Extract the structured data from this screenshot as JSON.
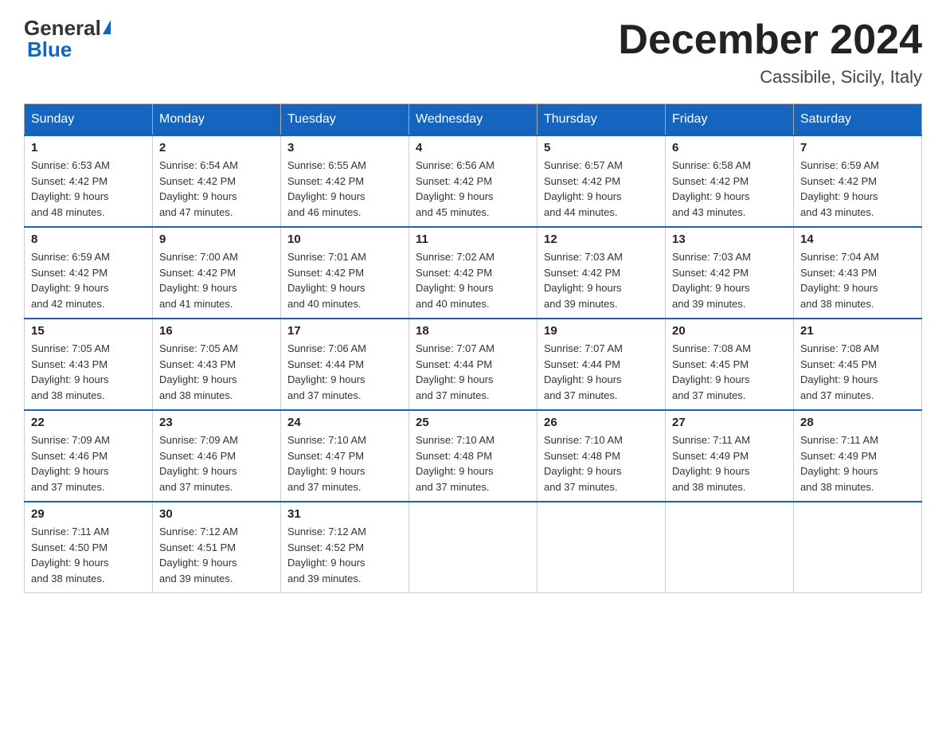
{
  "header": {
    "logo_general": "General",
    "logo_blue": "Blue",
    "month_title": "December 2024",
    "location": "Cassibile, Sicily, Italy"
  },
  "weekdays": [
    "Sunday",
    "Monday",
    "Tuesday",
    "Wednesday",
    "Thursday",
    "Friday",
    "Saturday"
  ],
  "weeks": [
    [
      {
        "day": "1",
        "sunrise": "6:53 AM",
        "sunset": "4:42 PM",
        "daylight": "9 hours and 48 minutes."
      },
      {
        "day": "2",
        "sunrise": "6:54 AM",
        "sunset": "4:42 PM",
        "daylight": "9 hours and 47 minutes."
      },
      {
        "day": "3",
        "sunrise": "6:55 AM",
        "sunset": "4:42 PM",
        "daylight": "9 hours and 46 minutes."
      },
      {
        "day": "4",
        "sunrise": "6:56 AM",
        "sunset": "4:42 PM",
        "daylight": "9 hours and 45 minutes."
      },
      {
        "day": "5",
        "sunrise": "6:57 AM",
        "sunset": "4:42 PM",
        "daylight": "9 hours and 44 minutes."
      },
      {
        "day": "6",
        "sunrise": "6:58 AM",
        "sunset": "4:42 PM",
        "daylight": "9 hours and 43 minutes."
      },
      {
        "day": "7",
        "sunrise": "6:59 AM",
        "sunset": "4:42 PM",
        "daylight": "9 hours and 43 minutes."
      }
    ],
    [
      {
        "day": "8",
        "sunrise": "6:59 AM",
        "sunset": "4:42 PM",
        "daylight": "9 hours and 42 minutes."
      },
      {
        "day": "9",
        "sunrise": "7:00 AM",
        "sunset": "4:42 PM",
        "daylight": "9 hours and 41 minutes."
      },
      {
        "day": "10",
        "sunrise": "7:01 AM",
        "sunset": "4:42 PM",
        "daylight": "9 hours and 40 minutes."
      },
      {
        "day": "11",
        "sunrise": "7:02 AM",
        "sunset": "4:42 PM",
        "daylight": "9 hours and 40 minutes."
      },
      {
        "day": "12",
        "sunrise": "7:03 AM",
        "sunset": "4:42 PM",
        "daylight": "9 hours and 39 minutes."
      },
      {
        "day": "13",
        "sunrise": "7:03 AM",
        "sunset": "4:42 PM",
        "daylight": "9 hours and 39 minutes."
      },
      {
        "day": "14",
        "sunrise": "7:04 AM",
        "sunset": "4:43 PM",
        "daylight": "9 hours and 38 minutes."
      }
    ],
    [
      {
        "day": "15",
        "sunrise": "7:05 AM",
        "sunset": "4:43 PM",
        "daylight": "9 hours and 38 minutes."
      },
      {
        "day": "16",
        "sunrise": "7:05 AM",
        "sunset": "4:43 PM",
        "daylight": "9 hours and 38 minutes."
      },
      {
        "day": "17",
        "sunrise": "7:06 AM",
        "sunset": "4:44 PM",
        "daylight": "9 hours and 37 minutes."
      },
      {
        "day": "18",
        "sunrise": "7:07 AM",
        "sunset": "4:44 PM",
        "daylight": "9 hours and 37 minutes."
      },
      {
        "day": "19",
        "sunrise": "7:07 AM",
        "sunset": "4:44 PM",
        "daylight": "9 hours and 37 minutes."
      },
      {
        "day": "20",
        "sunrise": "7:08 AM",
        "sunset": "4:45 PM",
        "daylight": "9 hours and 37 minutes."
      },
      {
        "day": "21",
        "sunrise": "7:08 AM",
        "sunset": "4:45 PM",
        "daylight": "9 hours and 37 minutes."
      }
    ],
    [
      {
        "day": "22",
        "sunrise": "7:09 AM",
        "sunset": "4:46 PM",
        "daylight": "9 hours and 37 minutes."
      },
      {
        "day": "23",
        "sunrise": "7:09 AM",
        "sunset": "4:46 PM",
        "daylight": "9 hours and 37 minutes."
      },
      {
        "day": "24",
        "sunrise": "7:10 AM",
        "sunset": "4:47 PM",
        "daylight": "9 hours and 37 minutes."
      },
      {
        "day": "25",
        "sunrise": "7:10 AM",
        "sunset": "4:48 PM",
        "daylight": "9 hours and 37 minutes."
      },
      {
        "day": "26",
        "sunrise": "7:10 AM",
        "sunset": "4:48 PM",
        "daylight": "9 hours and 37 minutes."
      },
      {
        "day": "27",
        "sunrise": "7:11 AM",
        "sunset": "4:49 PM",
        "daylight": "9 hours and 38 minutes."
      },
      {
        "day": "28",
        "sunrise": "7:11 AM",
        "sunset": "4:49 PM",
        "daylight": "9 hours and 38 minutes."
      }
    ],
    [
      {
        "day": "29",
        "sunrise": "7:11 AM",
        "sunset": "4:50 PM",
        "daylight": "9 hours and 38 minutes."
      },
      {
        "day": "30",
        "sunrise": "7:12 AM",
        "sunset": "4:51 PM",
        "daylight": "9 hours and 39 minutes."
      },
      {
        "day": "31",
        "sunrise": "7:12 AM",
        "sunset": "4:52 PM",
        "daylight": "9 hours and 39 minutes."
      },
      null,
      null,
      null,
      null
    ]
  ],
  "labels": {
    "sunrise": "Sunrise:",
    "sunset": "Sunset:",
    "daylight": "Daylight:"
  }
}
